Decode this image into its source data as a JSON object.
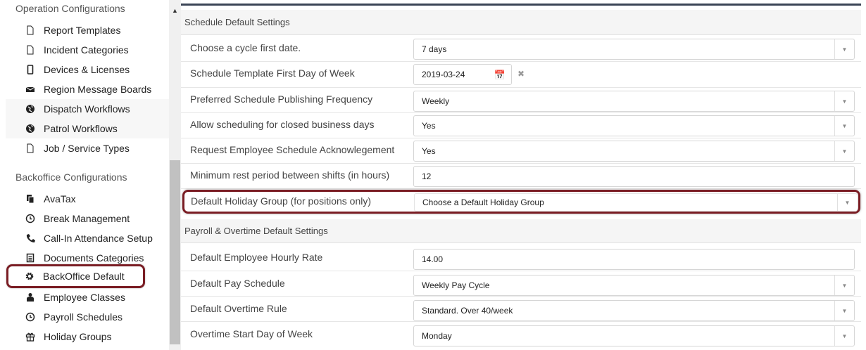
{
  "sidebar": {
    "operation_header": "Operation Configurations",
    "operation_items": [
      {
        "label": "Report Templates",
        "icon": "document-icon"
      },
      {
        "label": "Incident Categories",
        "icon": "document-icon"
      },
      {
        "label": "Devices & Licenses",
        "icon": "mobile-icon"
      },
      {
        "label": "Region Message Boards",
        "icon": "envelope-icon"
      },
      {
        "label": "Dispatch Workflows",
        "icon": "globe-icon"
      },
      {
        "label": "Patrol Workflows",
        "icon": "globe-icon"
      },
      {
        "label": "Job / Service Types",
        "icon": "document-icon"
      }
    ],
    "backoffice_header": "Backoffice Configurations",
    "backoffice_items": [
      {
        "label": "AvaTax",
        "icon": "copy-icon"
      },
      {
        "label": "Break Management",
        "icon": "clock-icon"
      },
      {
        "label": "Call-In Attendance Setup",
        "icon": "phone-icon"
      },
      {
        "label": "Documents Categories",
        "icon": "list-icon"
      },
      {
        "label": "BackOffice Default",
        "icon": "gear-icon"
      },
      {
        "label": "Employee Classes",
        "icon": "person-icon"
      },
      {
        "label": "Payroll Schedules",
        "icon": "clock-icon"
      },
      {
        "label": "Holiday Groups",
        "icon": "gift-icon"
      }
    ]
  },
  "schedule_section": {
    "title": "Schedule Default Settings",
    "rows": [
      {
        "label": "Choose a cycle first date.",
        "value": "7 days"
      },
      {
        "label": "Schedule Template First Day of Week",
        "value": "2019-03-24"
      },
      {
        "label": "Preferred Schedule Publishing Frequency",
        "value": "Weekly"
      },
      {
        "label": "Allow scheduling for closed business days",
        "value": "Yes"
      },
      {
        "label": "Request Employee Schedule Acknowlegement",
        "value": "Yes"
      },
      {
        "label": "Minimum rest period between shifts (in hours)",
        "value": "12"
      },
      {
        "label": "Default Holiday Group (for positions only)",
        "value": "Choose a Default Holiday Group"
      }
    ]
  },
  "payroll_section": {
    "title": "Payroll & Overtime Default Settings",
    "rows": [
      {
        "label": "Default Employee Hourly Rate",
        "value": "14.00"
      },
      {
        "label": "Default Pay Schedule",
        "value": "Weekly Pay Cycle"
      },
      {
        "label": "Default Overtime Rule",
        "value": "Standard. Over 40/week"
      },
      {
        "label": "Overtime Start Day of Week",
        "value": "Monday"
      }
    ]
  },
  "colors": {
    "highlight": "#7a1d24",
    "top_bar": "#3b4556"
  }
}
